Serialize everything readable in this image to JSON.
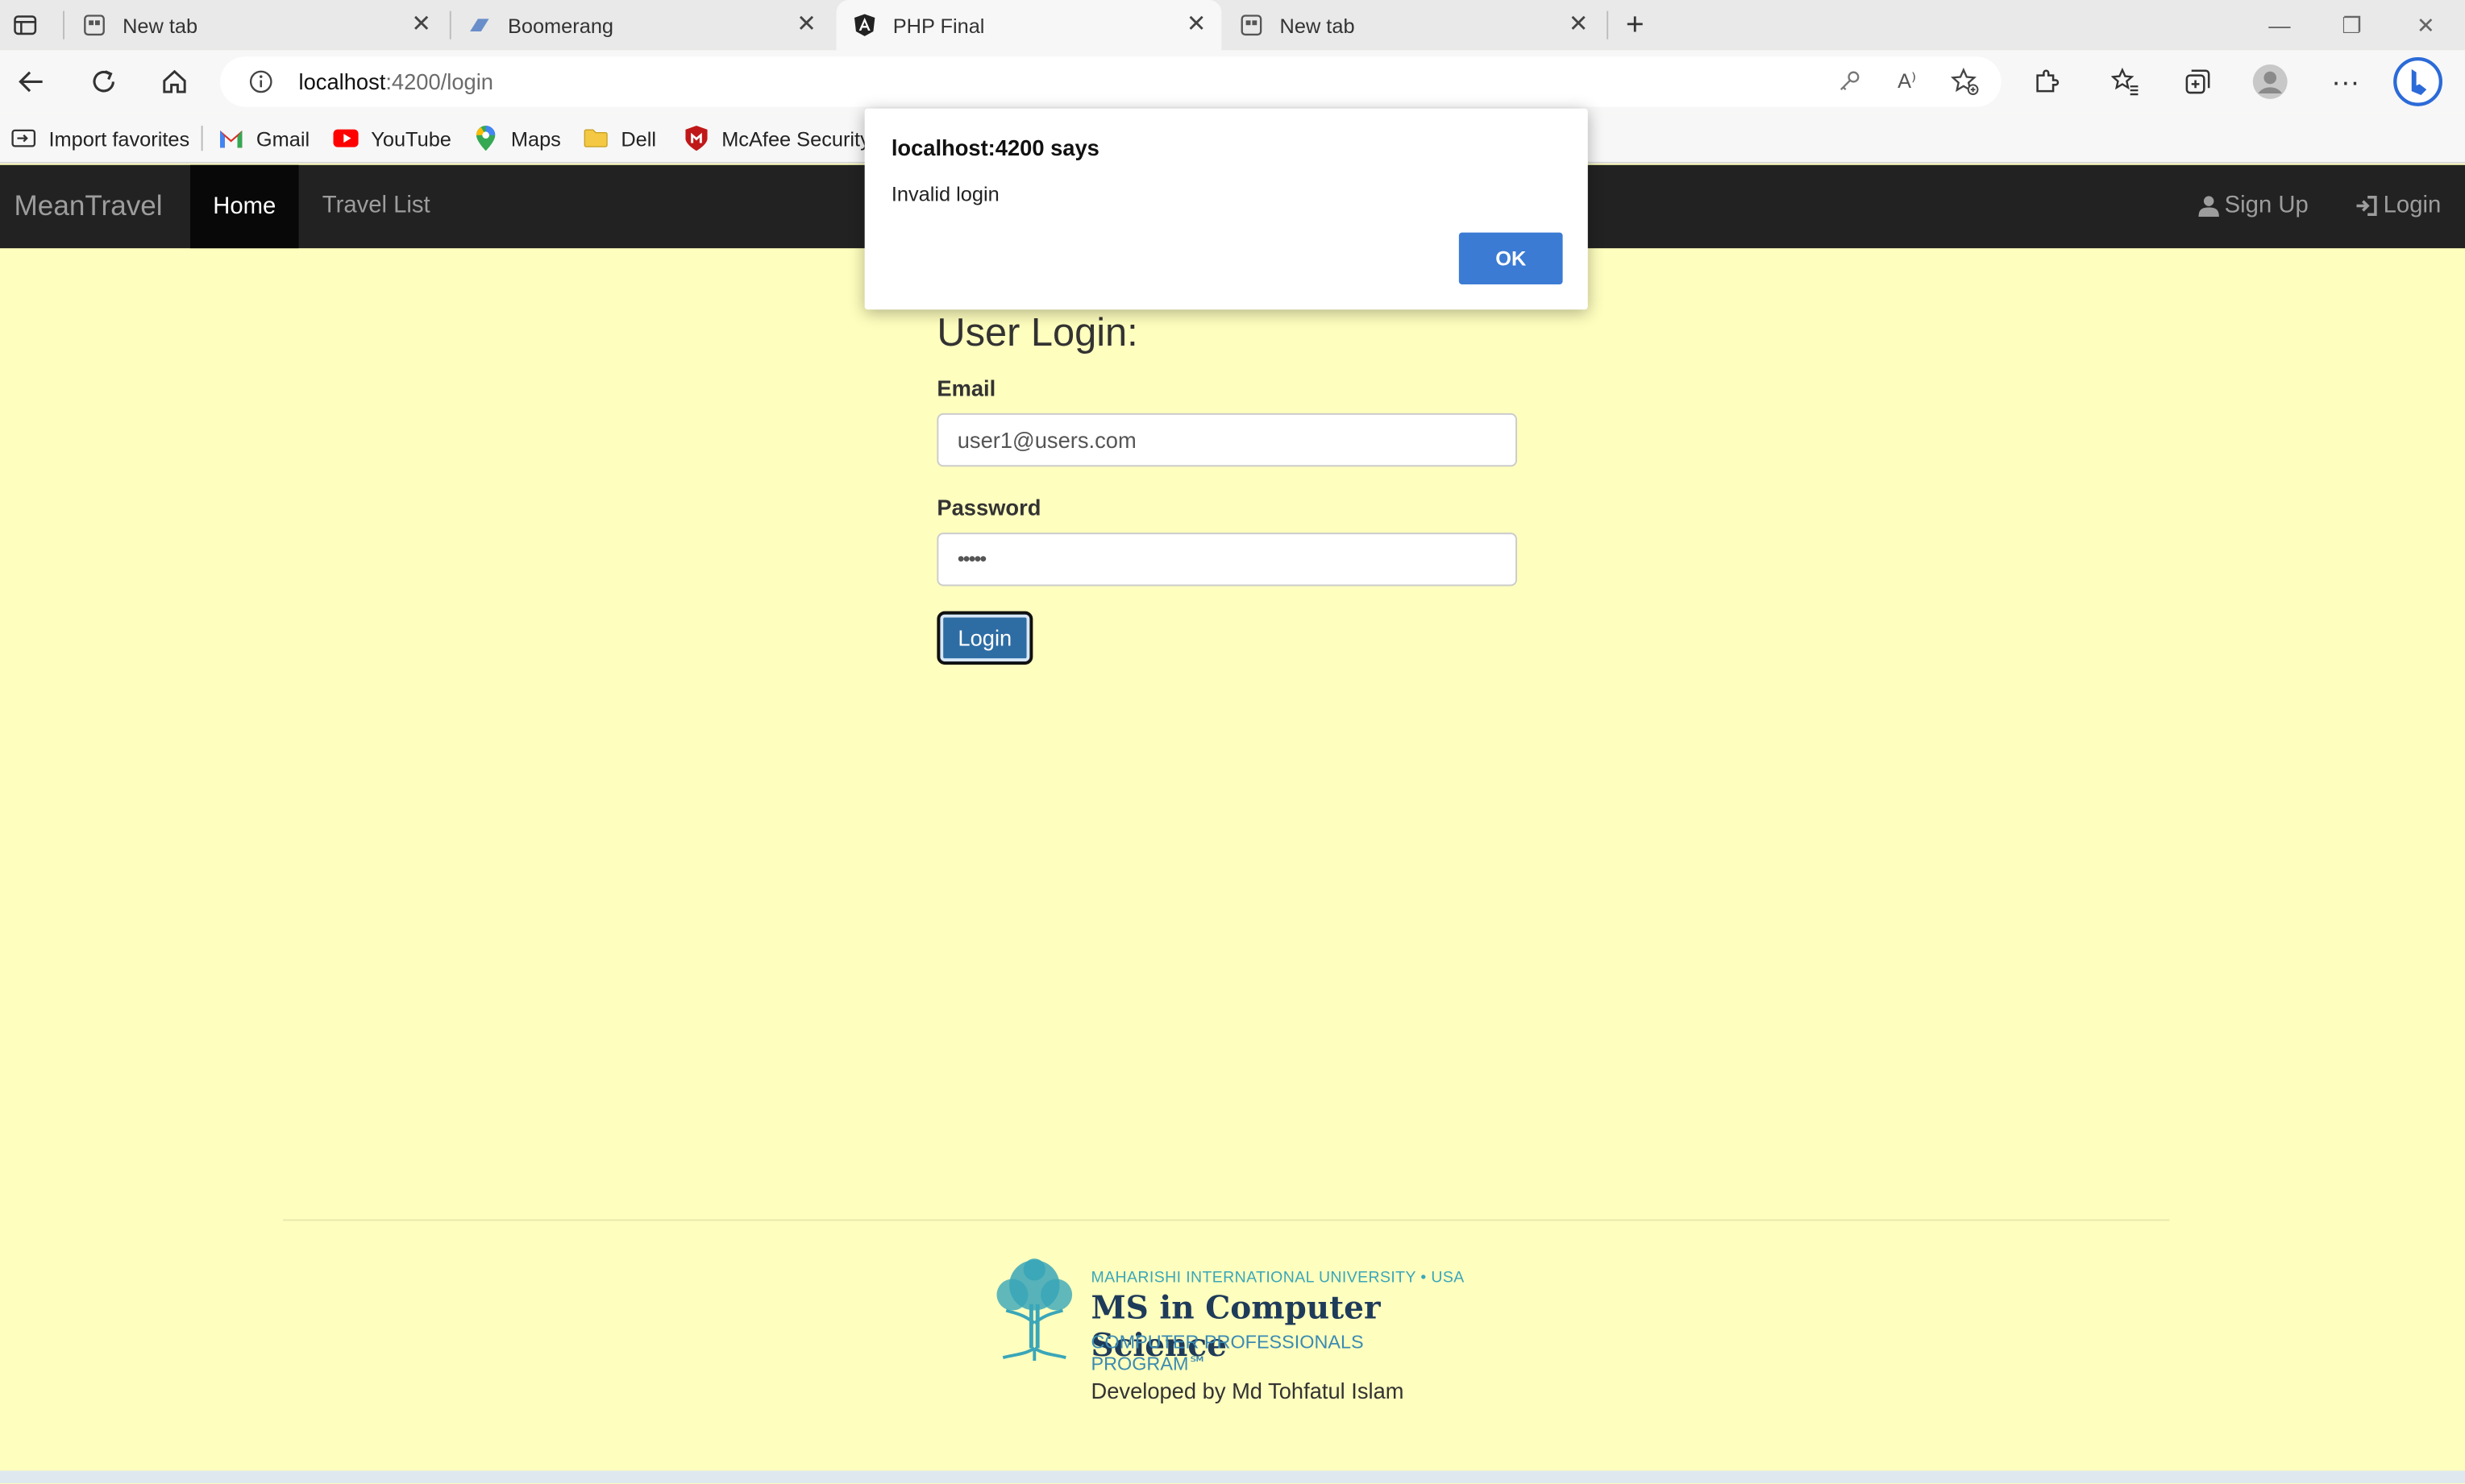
{
  "browser": {
    "tabs": [
      {
        "title": "New tab",
        "icon": "newtab-icon"
      },
      {
        "title": "Boomerang",
        "icon": "boomerang-icon"
      },
      {
        "title": "PHP Final",
        "icon": "angular-icon",
        "active": true
      },
      {
        "title": "New tab",
        "icon": "newtab-icon"
      }
    ],
    "address": {
      "host": "localhost",
      "path": ":4200/login"
    },
    "favorites": [
      {
        "label": "Import favorites",
        "icon": "import-icon"
      },
      {
        "label": "Gmail",
        "icon": "gmail-icon"
      },
      {
        "label": "YouTube",
        "icon": "youtube-icon"
      },
      {
        "label": "Maps",
        "icon": "maps-icon"
      },
      {
        "label": "Dell",
        "icon": "folder-icon"
      },
      {
        "label": "McAfee Security",
        "icon": "mcafee-icon"
      }
    ]
  },
  "navbar": {
    "brand": "MeanTravel",
    "home": "Home",
    "travel_list": "Travel List",
    "signup": "Sign Up",
    "login": "Login"
  },
  "form": {
    "title": "User Login:",
    "email_label": "Email",
    "email_value": "user1@users.com",
    "password_label": "Password",
    "password_value": "•••••",
    "submit": "Login"
  },
  "footer": {
    "logo_top": "MAHARISHI INTERNATIONAL UNIVERSITY • USA",
    "logo_main": "MS in Computer Science",
    "logo_sub": "COMPUTER PROFESSIONALS PROGRAM℠",
    "developer": "Developed by Md Tohfatul Islam"
  },
  "dialog": {
    "title": "localhost:4200 says",
    "message": "Invalid login",
    "ok": "OK"
  },
  "colors": {
    "page_bg": "#fefebe",
    "navbar_bg": "#222222",
    "primary_button": "#2e6da4",
    "dialog_ok": "#3b7bd4"
  }
}
